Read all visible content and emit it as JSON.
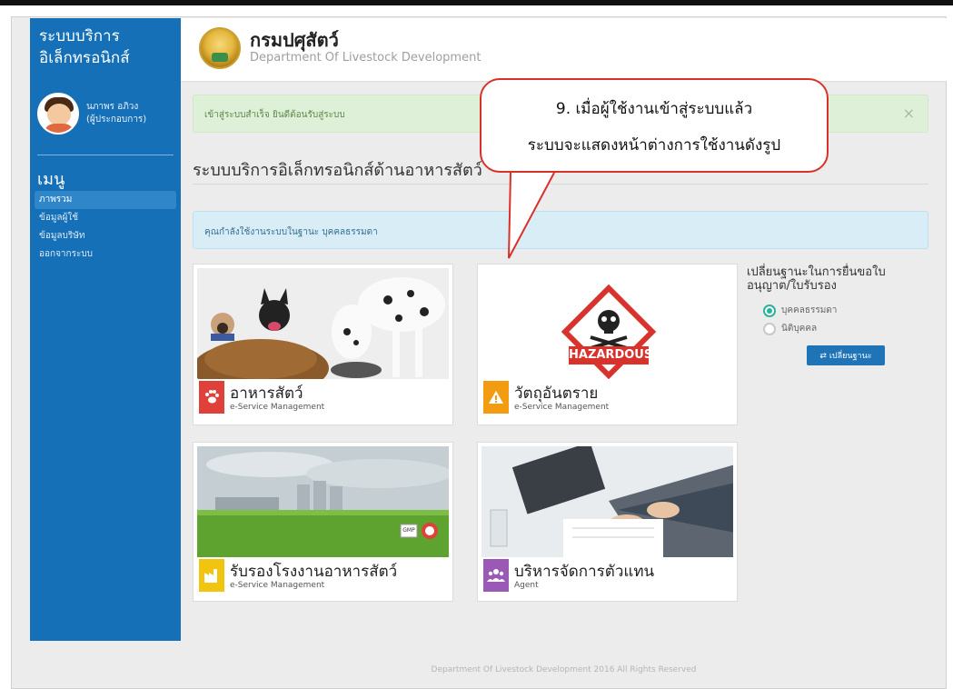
{
  "brand": {
    "line1": "ระบบบริการ",
    "line2": "อิเล็กทรอนิกส์"
  },
  "header": {
    "dept_th": "กรมปศุสัตว์",
    "dept_en": "Department Of Livestock Development"
  },
  "user": {
    "name": "นภาพร อภิวง",
    "role": "(ผู้ประกอบการ)"
  },
  "sidebar": {
    "menu_title": "เมนู",
    "items": [
      {
        "label": "ภาพรวม",
        "active": true
      },
      {
        "label": "ข้อมูลผู้ใช้",
        "active": false
      },
      {
        "label": "ข้อมูลบริษัท",
        "active": false
      },
      {
        "label": "ออกจากระบบ",
        "active": false
      }
    ]
  },
  "alerts": {
    "success": "เข้าสู่ระบบสำเร็จ ยินดีต้อนรับสู่ระบบ",
    "close": "×",
    "info": "คุณกำลังใช้งานระบบในฐานะ บุคคลธรรมดา"
  },
  "page_title": "ระบบบริการอิเล็กทรอนิกส์ด้านอาหารสัตว์",
  "cards": [
    {
      "title": "อาหารสัตว์",
      "subtitle": "e-Service Management",
      "icon": "paw-icon",
      "color": "#e0403a"
    },
    {
      "title": "วัตถุอันตราย",
      "subtitle": "e-Service Management",
      "icon": "warning-icon",
      "color": "#f39c12"
    },
    {
      "title": "รับรองโรงงานอาหารสัตว์",
      "subtitle": "e-Service Management",
      "icon": "factory-icon",
      "color": "#f1c40f"
    },
    {
      "title": "บริหารจัดการตัวแทน",
      "subtitle": "Agent",
      "icon": "users-icon",
      "color": "#9b59b6"
    }
  ],
  "hazard_label": "HAZARDOUS",
  "gmp_label": "GMP",
  "switch_panel": {
    "title": "เปลี่ยนฐานะในการยื่นขอใบอนุญาต/ใบรับรอง",
    "options": [
      {
        "label": "บุคคลธรรมดา",
        "selected": true
      },
      {
        "label": "นิติบุคคล",
        "selected": false
      }
    ],
    "button": "⇄ เปลี่ยนฐานะ"
  },
  "footer": "Department Of Livestock Development 2016 All Rights Reserved",
  "callout": {
    "line1": "9. เมื่อผู้ใช้งานเข้าสู่ระบบแล้ว",
    "line2": "ระบบจะแสดงหน้าต่างการใช้งานดังรูป"
  },
  "colors": {
    "sidebar": "#1570b8",
    "success_bg": "#dff0d8",
    "info_bg": "#d9edf7",
    "callout_border": "#d9312a"
  }
}
